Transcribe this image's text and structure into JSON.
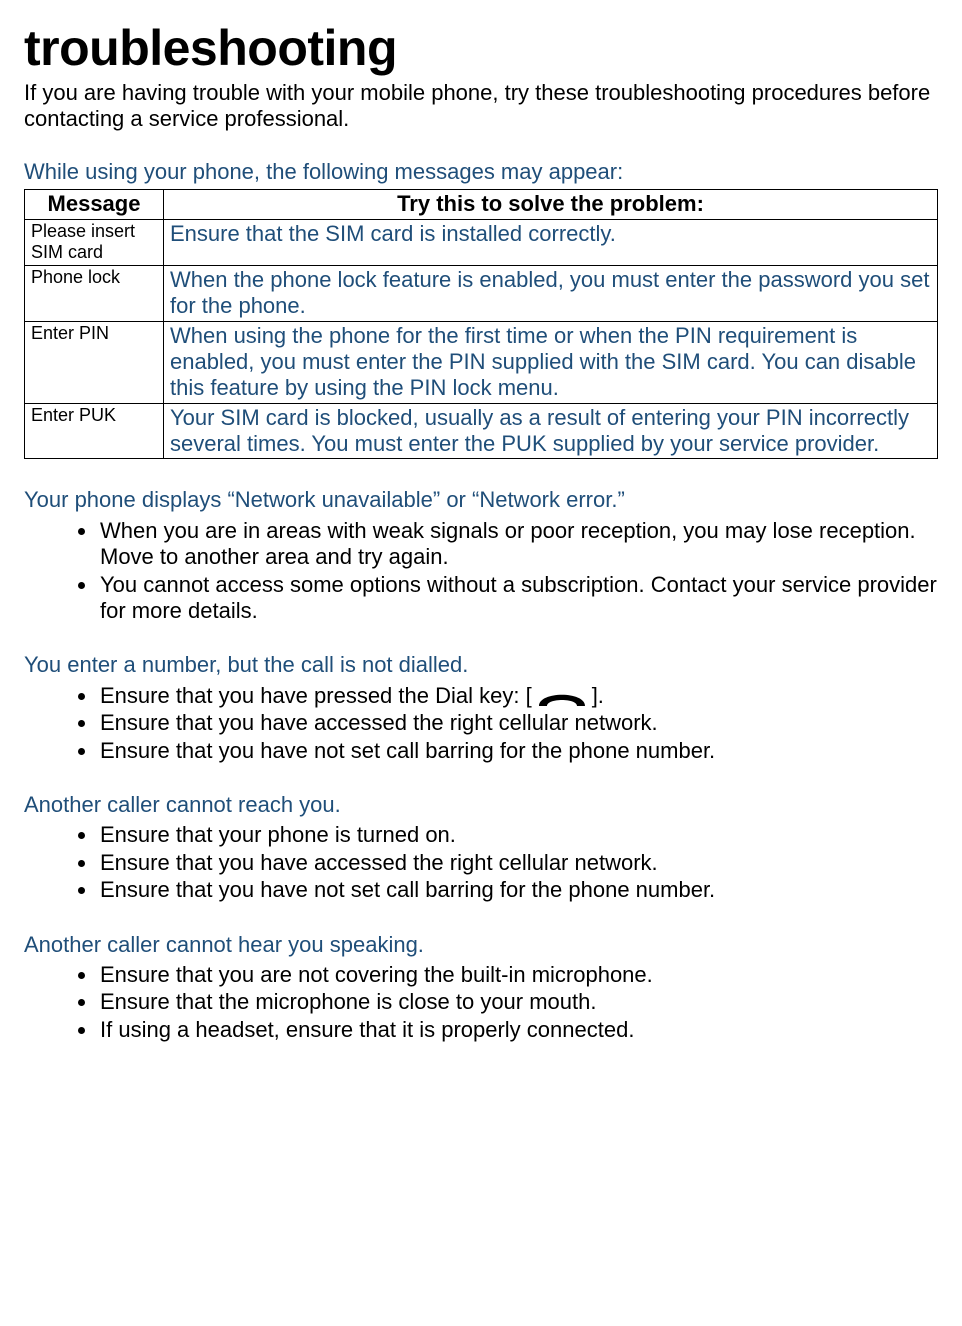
{
  "title": "troubleshooting",
  "intro": "If you are having trouble with your mobile phone, try these troubleshooting procedures before contacting a service professional.",
  "section1": {
    "heading": "While using your phone, the following messages may appear:",
    "col1": "Message",
    "col2": "Try this to solve the problem:",
    "rows": [
      {
        "message": "Please insert SIM card",
        "solution": "Ensure that the SIM card is installed correctly."
      },
      {
        "message": "Phone lock",
        "solution": "When the phone lock feature is enabled, you must enter the password you set for the phone."
      },
      {
        "message": "Enter PIN",
        "solution": "When using the phone for the first time or when the PIN requirement is enabled, you must enter the PIN supplied with the SIM card. You can disable this feature by using the PIN lock    menu."
      },
      {
        "message": "Enter PUK",
        "solution": "Your SIM card is blocked, usually as a result of entering your PIN incorrectly several times. You must enter the PUK supplied by your service provider."
      }
    ]
  },
  "section2": {
    "heading": "Your phone displays “Network unavailable” or “Network error.”",
    "items": [
      "When you are in areas with weak signals or poor reception, you may lose reception. Move to another area and try again.",
      "You cannot access some options without a subscription. Contact your service provider for more details."
    ]
  },
  "section3": {
    "heading": "You enter a number, but the call is not dialled.",
    "item1_pre": "Ensure that you have pressed the Dial key: [",
    "item1_post": "].",
    "item2": "Ensure that you have accessed the right cellular network.",
    "item3": "Ensure that you have not set call barring for the phone number."
  },
  "section4": {
    "heading": "Another caller cannot reach you.",
    "items": [
      "Ensure that your phone is turned on.",
      "Ensure that you have accessed the right cellular network.",
      "Ensure that you have not set call barring for the phone number."
    ]
  },
  "section5": {
    "heading": "Another caller cannot hear you speaking.",
    "items": [
      "Ensure that you are not covering the built-in microphone.",
      "Ensure that the microphone is close to your mouth.",
      "If using a headset, ensure that it is properly connected."
    ]
  }
}
